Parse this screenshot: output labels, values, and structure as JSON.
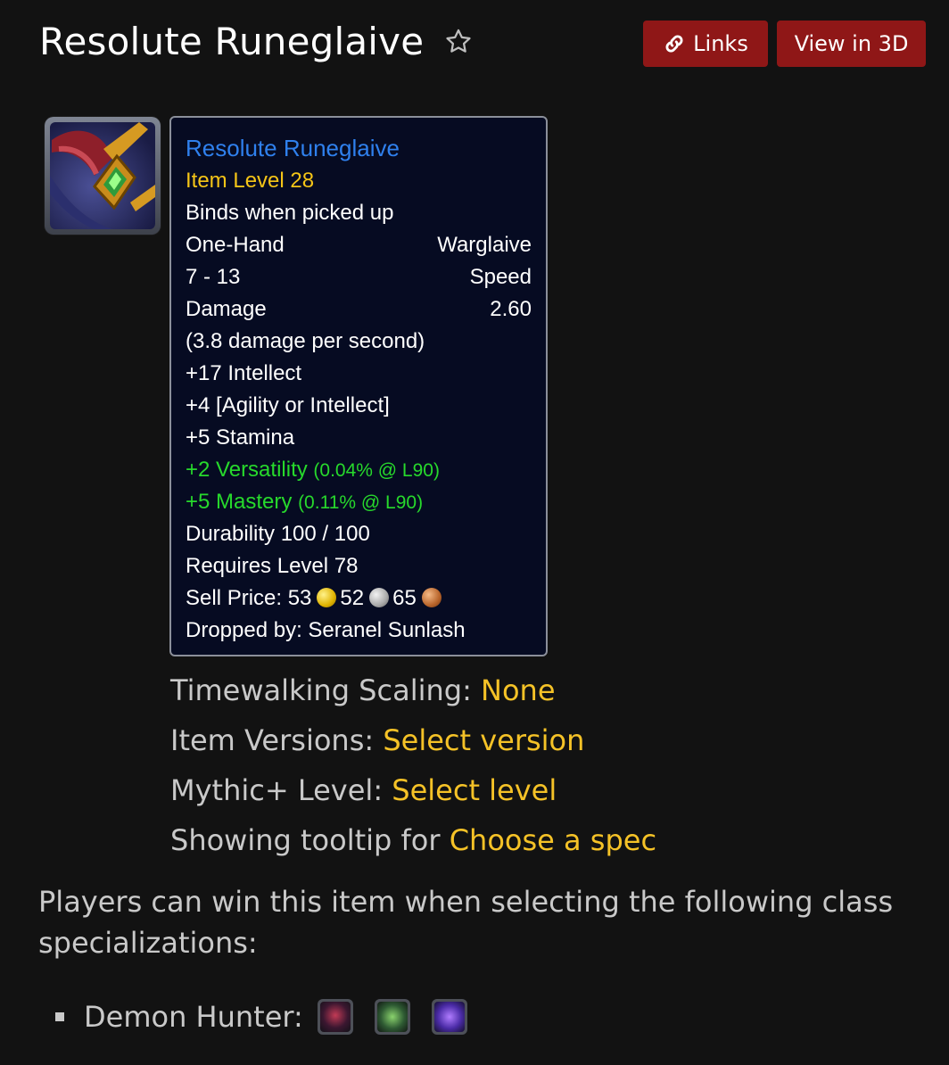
{
  "page": {
    "title": "Resolute Runeglaive",
    "favorite_icon": "star-outline-icon"
  },
  "header_buttons": {
    "links_label": "Links",
    "links_icon": "link-chain-icon",
    "view3d_label": "View in 3D",
    "color": "#8f1717"
  },
  "item_icon": "warglaive-item-icon",
  "tooltip": {
    "name": "Resolute Runeglaive",
    "item_level": "Item Level 28",
    "binding": "Binds when picked up",
    "slot": "One-Hand",
    "type": "Warglaive",
    "damage_range": "7 - 13",
    "speed_label": "Speed",
    "damage_label": "Damage",
    "speed_value": "2.60",
    "dps": "(3.8 damage per second)",
    "stats": [
      "+17 Intellect",
      "+4 [Agility or Intellect]",
      "+5 Stamina"
    ],
    "secondary": [
      {
        "stat": "+2 Versatility",
        "note": "(0.04% @ L90)"
      },
      {
        "stat": "+5 Mastery",
        "note": "(0.11% @ L90)"
      }
    ],
    "durability": "Durability 100 / 100",
    "requires": "Requires Level 78",
    "sell_price_label": "Sell Price: ",
    "sell_price": {
      "gold": "53",
      "silver": "52",
      "copper": "65"
    },
    "dropped_by": "Dropped by: Seranel Sunlash",
    "colors": {
      "name": "#2f80ed",
      "item_level": "#f5c517",
      "green": "#27d92c"
    }
  },
  "options": [
    {
      "label": "Timewalking Scaling: ",
      "value": "None"
    },
    {
      "label": "Item Versions: ",
      "value": "Select version"
    },
    {
      "label": "Mythic+ Level: ",
      "value": "Select level"
    },
    {
      "label": "Showing tooltip for ",
      "value": "Choose a spec"
    }
  ],
  "description": "Players can win this item when selecting the following class specializations:",
  "specs": {
    "class_label": "Demon Hunter:",
    "icons": [
      "havoc-spec-icon",
      "vengeance-spec-icon",
      "devourer-spec-icon"
    ]
  }
}
